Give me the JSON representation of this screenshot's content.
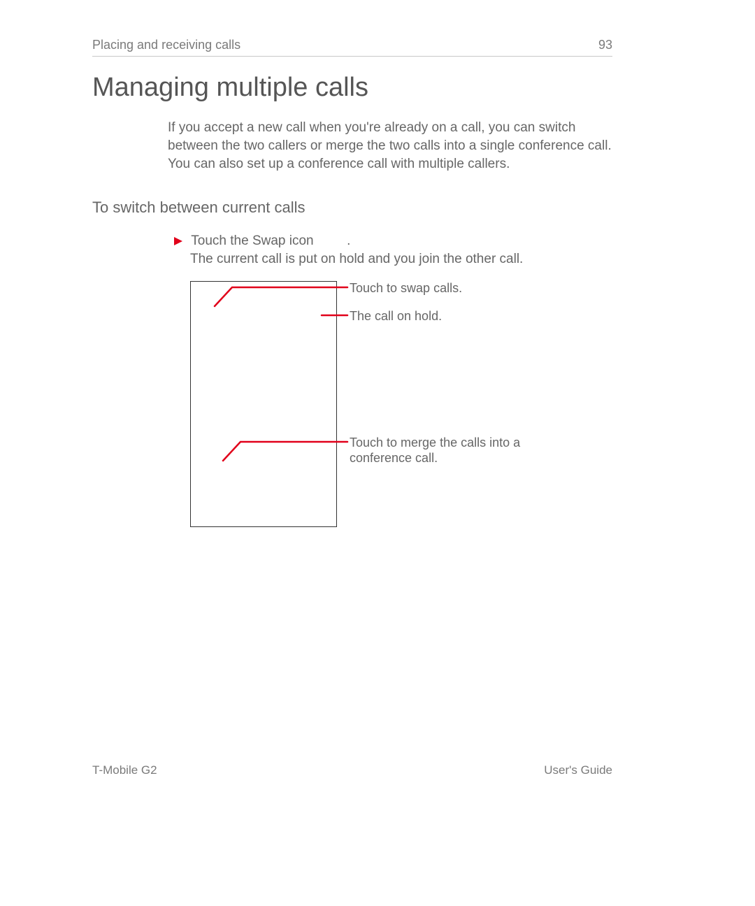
{
  "header": {
    "running_title": "Placing and receiving calls",
    "page_number": "93"
  },
  "title": "Managing multiple calls",
  "intro": "If you accept a new call when you're already on a call, you can switch between the two callers or merge the two calls into a single conference call. You can also set up a conference call with multiple callers.",
  "subhead": "To switch between current calls",
  "step": {
    "text": "Touch the Swap icon",
    "trailing_punct": ".",
    "sub": "The current call is put on hold and you join the other call."
  },
  "callouts": {
    "swap": "Touch to swap calls.",
    "hold": "The call on hold.",
    "merge": "Touch to merge the calls into a conference call."
  },
  "footer": {
    "left": "T-Mobile G2",
    "right": "User's Guide"
  },
  "colors": {
    "accent_red": "#e1001a"
  }
}
